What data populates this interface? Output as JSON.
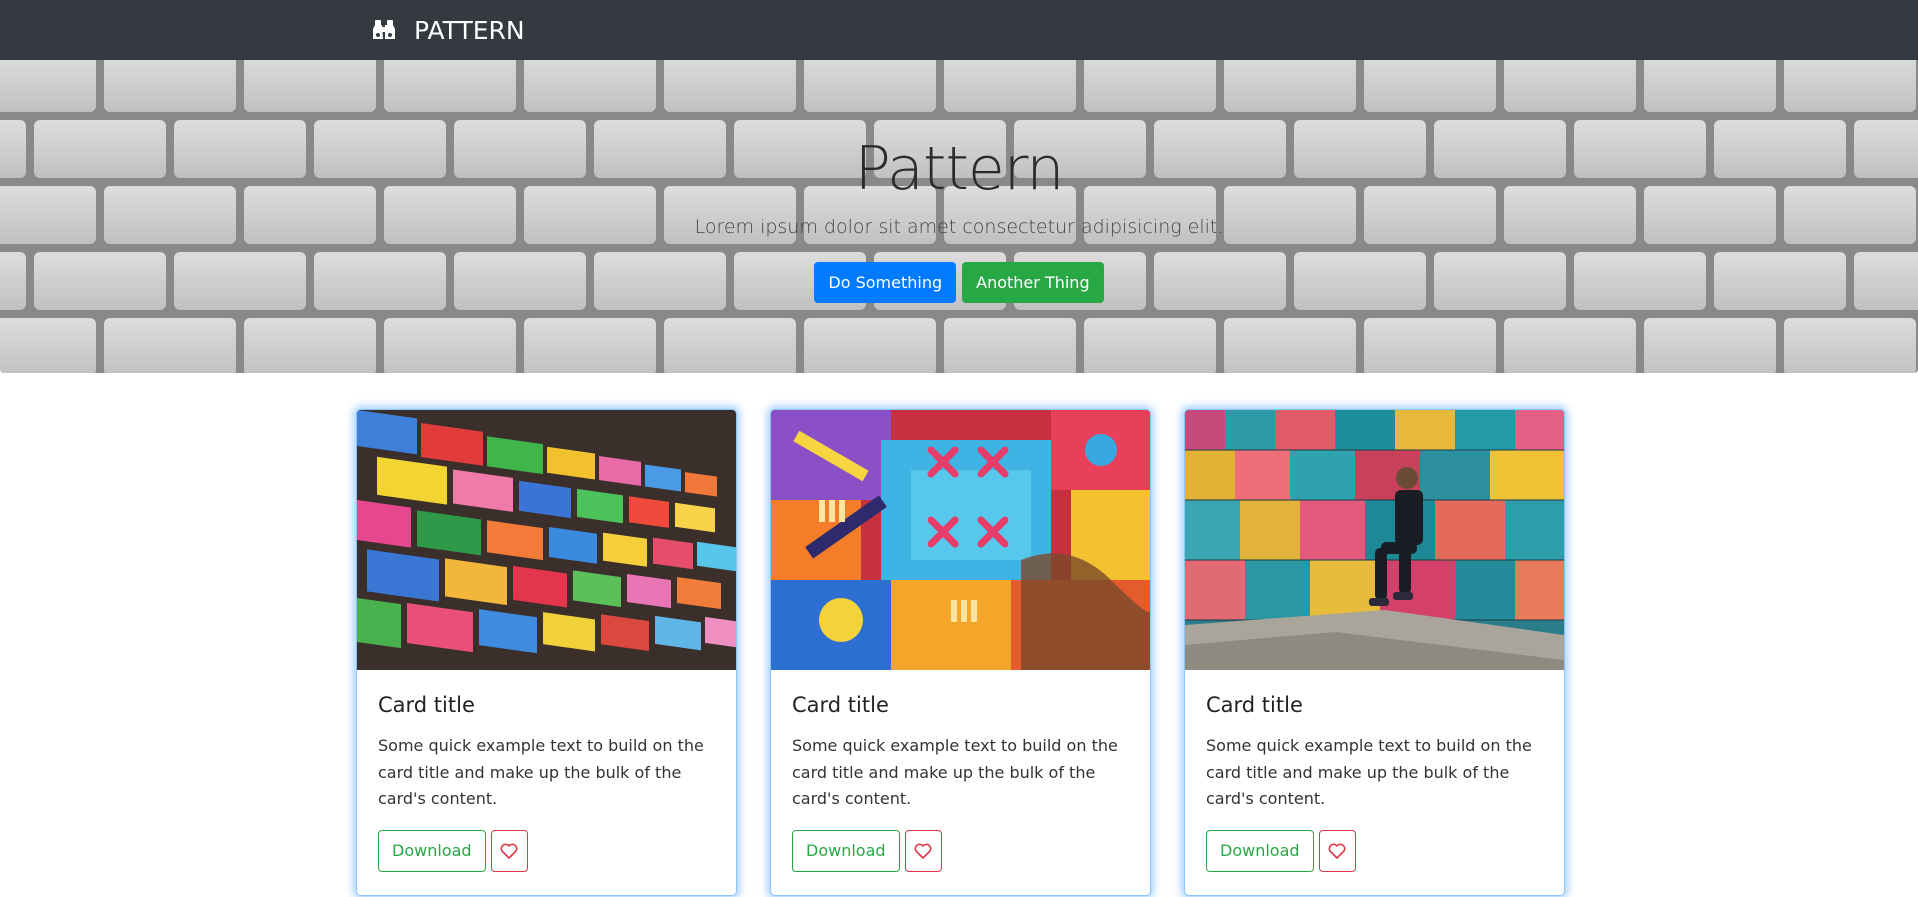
{
  "navbar": {
    "brand_icon": "binoculars-icon",
    "brand_text": "PATTERN",
    "background": "#343a40"
  },
  "hero": {
    "title": "Pattern",
    "lead": "Lorem ipsum dolor sit amet consectetur adipisicing elit.",
    "primary_button": "Do Something",
    "secondary_button": "Another Thing",
    "primary_color": "#007bff",
    "secondary_color": "#28a745"
  },
  "cards": [
    {
      "title": "Card title",
      "text": "Some quick example text to build on the card title and make up the bulk of the card's content.",
      "download_label": "Download",
      "like_icon": "heart-icon"
    },
    {
      "title": "Card title",
      "text": "Some quick example text to build on the card title and make up the bulk of the card's content.",
      "download_label": "Download",
      "like_icon": "heart-icon"
    },
    {
      "title": "Card title",
      "text": "Some quick example text to build on the card title and make up the bulk of the card's content.",
      "download_label": "Download",
      "like_icon": "heart-icon"
    }
  ]
}
